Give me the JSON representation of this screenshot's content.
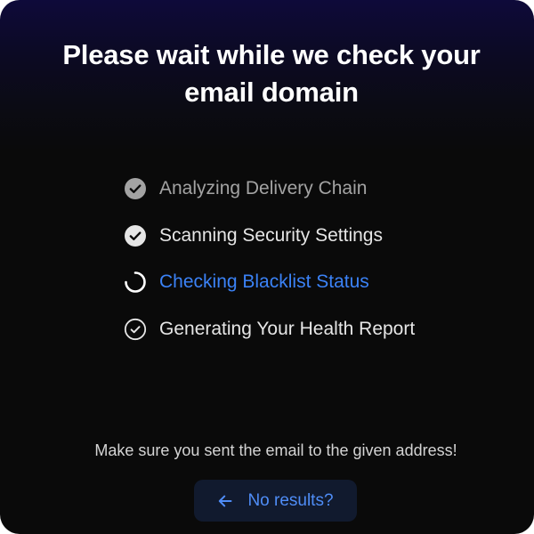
{
  "header": {
    "title": "Please wait while we check your email domain"
  },
  "steps": [
    {
      "label": "Analyzing Delivery Chain",
      "status": "completed",
      "icon": "check-circle-filled-icon"
    },
    {
      "label": "Scanning Security Settings",
      "status": "completed",
      "icon": "check-circle-filled-icon"
    },
    {
      "label": "Checking Blacklist Status",
      "status": "in-progress",
      "icon": "spinner-icon"
    },
    {
      "label": "Generating Your Health Report",
      "status": "pending",
      "icon": "check-circle-outline-icon"
    }
  ],
  "footer": {
    "note": "Make sure you sent the email to the given address!",
    "button_label": "No results?",
    "button_icon": "arrow-left-icon"
  },
  "colors": {
    "accent": "#3b82f6",
    "button_background": "#111a2e",
    "background": "#0a0a0a",
    "header_gradient_top": "#0e0a3a"
  }
}
